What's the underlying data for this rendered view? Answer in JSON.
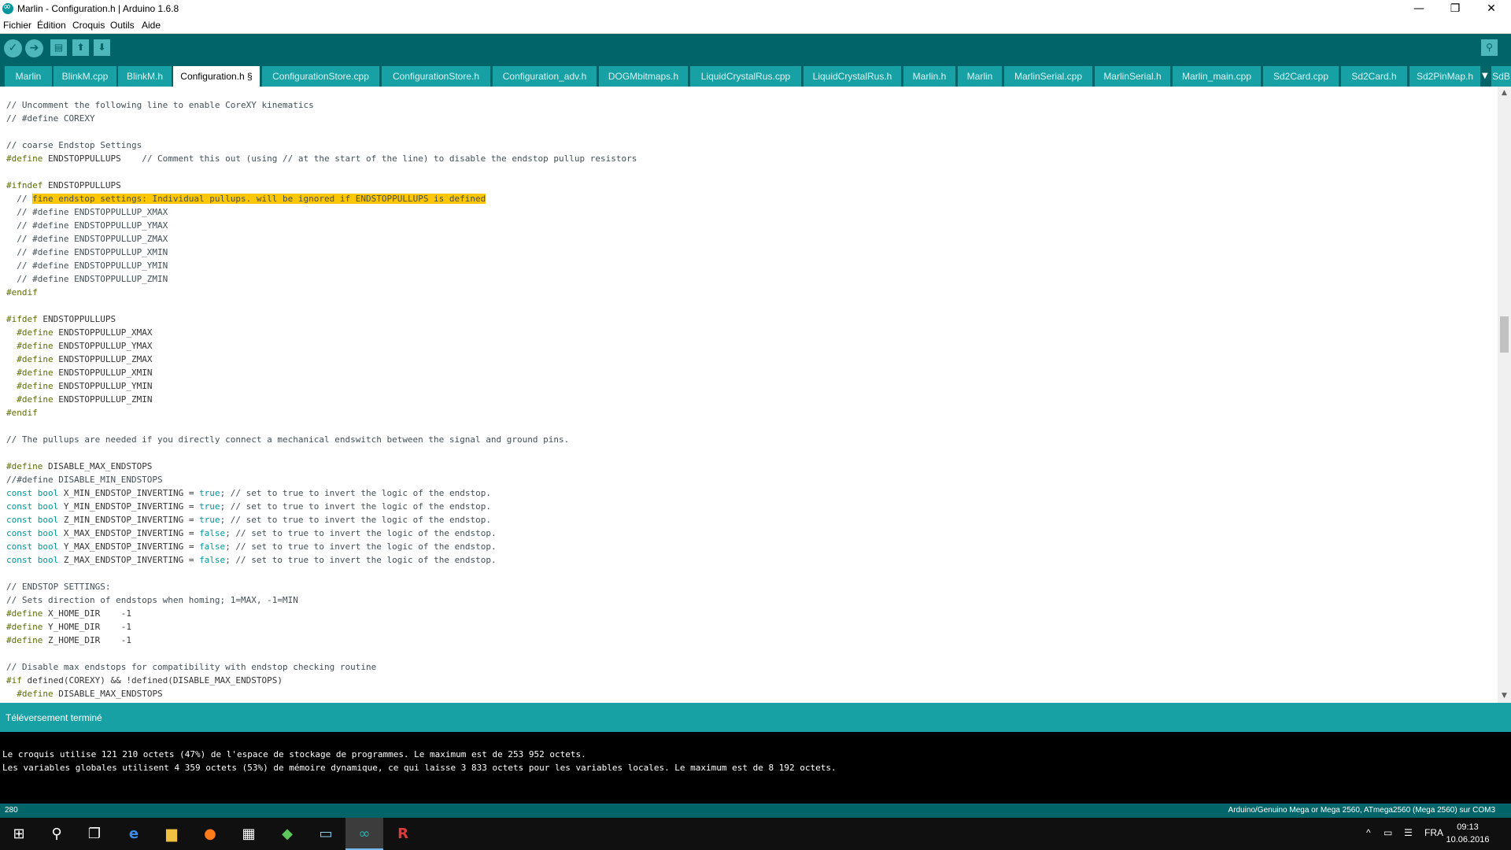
{
  "window": {
    "title": "Marlin - Configuration.h | Arduino 1.6.8",
    "minimize": "—",
    "restore": "❐",
    "close": "✕"
  },
  "menu": [
    "Fichier",
    "Édition",
    "Croquis",
    "Outils",
    "Aide"
  ],
  "toolbar": {
    "verify": "✓",
    "upload": "➔",
    "new": "▤",
    "open": "⬆",
    "save": "⬇",
    "serial_monitor": "⚲"
  },
  "tabs": [
    "Marlin",
    "BlinkM.cpp",
    "BlinkM.h",
    "Configuration.h §",
    "ConfigurationStore.cpp",
    "ConfigurationStore.h",
    "Configuration_adv.h",
    "DOGMbitmaps.h",
    "LiquidCrystalRus.cpp",
    "LiquidCrystalRus.h",
    "Marlin.h",
    "Marlin",
    "MarlinSerial.cpp",
    "MarlinSerial.h",
    "Marlin_main.cpp",
    "Sd2Card.cpp",
    "Sd2Card.h",
    "Sd2PinMap.h",
    "SdB"
  ],
  "active_tab_index": 3,
  "tab_overflow_icon": "▼",
  "code": {
    "l1": "// Uncomment the following line to enable CoreXY kinematics",
    "l2": "// #define COREXY",
    "l4": "// coarse Endstop Settings",
    "l5_pp": "#define",
    "l5_name": " ENDSTOPPULLUPS",
    "l5_cmt": "    // Comment this out (using // at the start of the line) to disable the endstop pullup resistors",
    "l7_pp": "#ifndef",
    "l7_name": " ENDSTOPPULLUPS",
    "l8_pre": "  // ",
    "l8_hl": "fine endstop settings: Individual pullups. will be ignored if ENDSTOPPULLUPS is defined",
    "l9": "  // #define ENDSTOPPULLUP_XMAX",
    "l10": "  // #define ENDSTOPPULLUP_YMAX",
    "l11": "  // #define ENDSTOPPULLUP_ZMAX",
    "l12": "  // #define ENDSTOPPULLUP_XMIN",
    "l13": "  // #define ENDSTOPPULLUP_YMIN",
    "l14": "  // #define ENDSTOPPULLUP_ZMIN",
    "l15": "#endif",
    "l17_pp": "#ifdef",
    "l17_name": " ENDSTOPPULLUPS",
    "l18_pp": "  #define",
    "l18_name": " ENDSTOPPULLUP_XMAX",
    "l19_pp": "  #define",
    "l19_name": " ENDSTOPPULLUP_YMAX",
    "l20_pp": "  #define",
    "l20_name": " ENDSTOPPULLUP_ZMAX",
    "l21_pp": "  #define",
    "l21_name": " ENDSTOPPULLUP_XMIN",
    "l22_pp": "  #define",
    "l22_name": " ENDSTOPPULLUP_YMIN",
    "l23_pp": "  #define",
    "l23_name": " ENDSTOPPULLUP_ZMIN",
    "l24": "#endif",
    "l26": "// The pullups are needed if you directly connect a mechanical endswitch between the signal and ground pins.",
    "l28_pp": "#define",
    "l28_name": " DISABLE_MAX_ENDSTOPS",
    "l29": "//#define DISABLE_MIN_ENDSTOPS",
    "const_kw": "const",
    "bool_kw": " bool",
    "c1_name": " X_MIN_ENDSTOP_INVERTING = ",
    "c1_val": "true",
    "c2_name": " Y_MIN_ENDSTOP_INVERTING = ",
    "c2_val": "true",
    "c3_name": " Z_MIN_ENDSTOP_INVERTING = ",
    "c3_val": "true",
    "c4_name": " X_MAX_ENDSTOP_INVERTING = ",
    "c4_val": "false",
    "c5_name": " Y_MAX_ENDSTOP_INVERTING = ",
    "c5_val": "false",
    "c6_name": " Z_MAX_ENDSTOP_INVERTING = ",
    "c6_val": "false",
    "c_tail": "; // set to true to invert the logic of the endstop.",
    "l37": "// ENDSTOP SETTINGS:",
    "l38": "// Sets direction of endstops when homing; 1=MAX, -1=MIN",
    "l39_pp": "#define",
    "l39_name": " X_HOME_DIR    -1",
    "l40_pp": "#define",
    "l40_name": " Y_HOME_DIR    -1",
    "l41_pp": "#define",
    "l41_name": " Z_HOME_DIR    -1",
    "l43": "// Disable max endstops for compatibility with endstop checking routine",
    "l44_pp": "#if",
    "l44_rest": " defined(COREXY) && !defined(DISABLE_MAX_ENDSTOPS)",
    "l45_pp": "  #define",
    "l45_name": " DISABLE_MAX_ENDSTOPS"
  },
  "scroll_up": "▲",
  "scroll_down": "▼",
  "status": "Téléversement terminé",
  "console": [
    "Le croquis utilise 121 210 octets (47%) de l'espace de stockage de programmes. Le maximum est de 253 952 octets.",
    "Les variables globales utilisent 4 359 octets (53%) de mémoire dynamique, ce qui laisse 3 833 octets pour les variables locales. Le maximum est de 8 192 octets."
  ],
  "footer": {
    "line": "280",
    "board": "Arduino/Genuino Mega or Mega 2560, ATmega2560 (Mega 2560) sur COM3"
  },
  "taskbar": {
    "start": "⊞",
    "search": "⚲",
    "task_view": "❐",
    "edge": "e",
    "explorer": "▆",
    "firefox": "●",
    "calculator": "▦",
    "app6": "◆",
    "app7": "▭",
    "arduino": "∞",
    "app9": "R",
    "tray_chevron": "^",
    "tray_network": "▭",
    "tray_msg": "☰",
    "lang": "FRA",
    "time": "09:13",
    "date": "10.06.2016"
  }
}
